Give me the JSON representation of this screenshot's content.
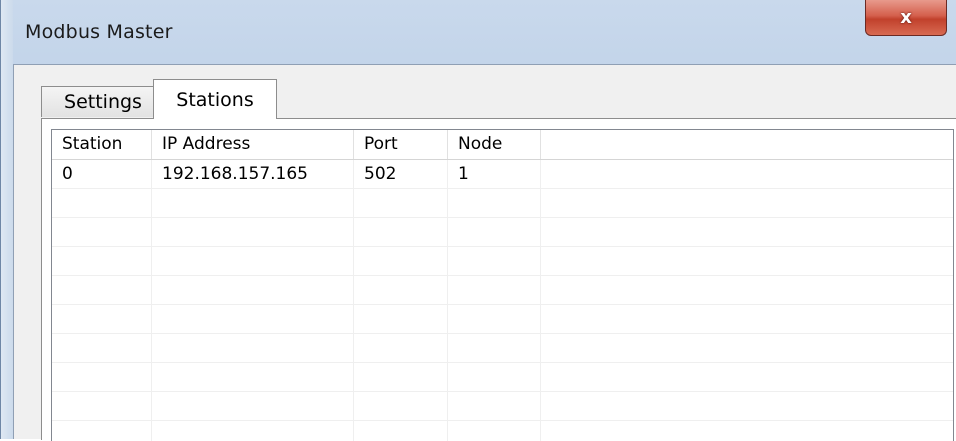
{
  "window": {
    "title": "Modbus Master",
    "close_label": "x"
  },
  "tabs": [
    {
      "label": "Settings",
      "active": false
    },
    {
      "label": "Stations",
      "active": true
    }
  ],
  "table": {
    "columns": [
      "Station",
      "IP Address",
      "Port",
      "Node"
    ],
    "rows": [
      [
        "0",
        "192.168.157.165",
        "502",
        "1"
      ]
    ]
  }
}
